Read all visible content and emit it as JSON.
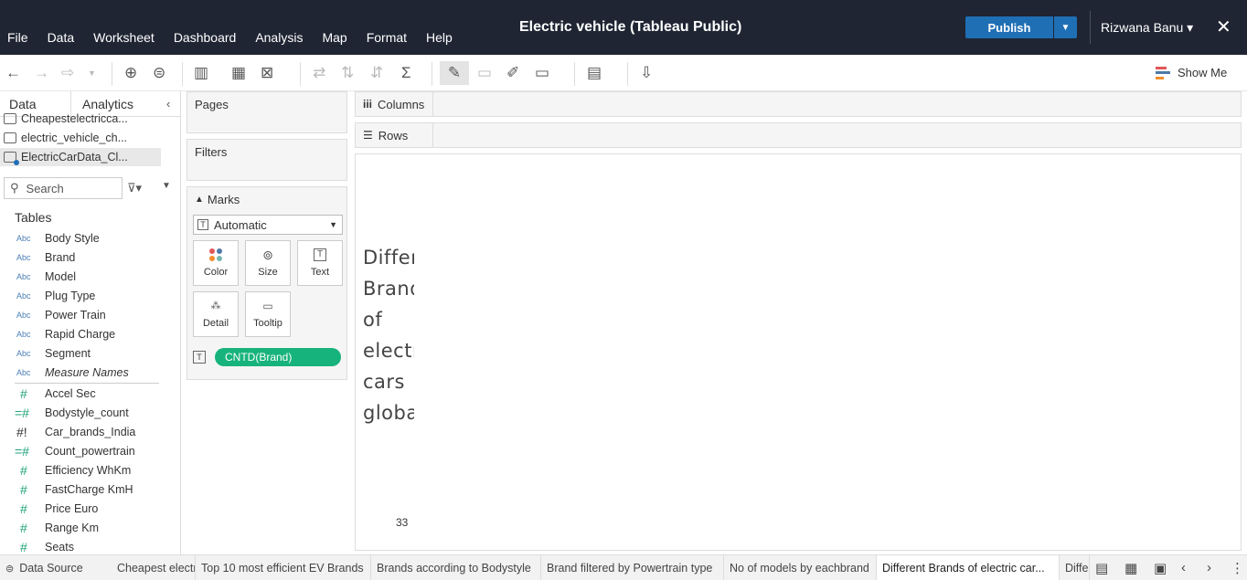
{
  "menu": [
    "File",
    "Data",
    "Worksheet",
    "Dashboard",
    "Analysis",
    "Map",
    "Format",
    "Help"
  ],
  "app_title": "Electric vehicle (Tableau Public)",
  "publish_label": "Publish",
  "user_name": "Rizwana Banu ▾",
  "toolbar": {
    "show_me_label": "Show Me"
  },
  "data_pane": {
    "tab_data": "Data",
    "tab_analytics": "Analytics",
    "sources": [
      "Cheapestelectricca...",
      "electric_vehicle_ch...",
      "ElectricCarData_Cl..."
    ],
    "search_placeholder": "Search",
    "tables_label": "Tables",
    "dimensions": [
      {
        "type": "Abc",
        "name": "Body Style"
      },
      {
        "type": "Abc",
        "name": "Brand"
      },
      {
        "type": "Abc",
        "name": "Model"
      },
      {
        "type": "Abc",
        "name": "Plug Type"
      },
      {
        "type": "Abc",
        "name": "Power Train"
      },
      {
        "type": "Abc",
        "name": "Rapid Charge"
      },
      {
        "type": "Abc",
        "name": "Segment"
      },
      {
        "type": "Abc",
        "name": "Measure Names"
      }
    ],
    "measures": [
      {
        "type": "#",
        "name": "Accel Sec"
      },
      {
        "type": "=#",
        "name": "Bodystyle_count"
      },
      {
        "type": "#!",
        "name": "Car_brands_India"
      },
      {
        "type": "=#",
        "name": "Count_powertrain"
      },
      {
        "type": "#",
        "name": "Efficiency WhKm"
      },
      {
        "type": "#",
        "name": "FastCharge KmH"
      },
      {
        "type": "#",
        "name": "Price Euro"
      },
      {
        "type": "#",
        "name": "Range Km"
      },
      {
        "type": "#",
        "name": "Seats"
      }
    ]
  },
  "cards": {
    "pages": "Pages",
    "filters": "Filters",
    "marks": "Marks",
    "mark_type": "Automatic",
    "mark_buttons": [
      "Color",
      "Size",
      "Text",
      "Detail",
      "Tooltip"
    ],
    "pill": "CNTD(Brand)"
  },
  "shelves": {
    "columns": "Columns",
    "rows": "Rows"
  },
  "viz": {
    "title": "Different\nBrands\nof\nelectric\ncars\nglobally",
    "value": "33"
  },
  "sheets": {
    "data_source": "Data Source",
    "tabs": [
      "Cheapest electric cars in India",
      "Top 10 most efficient EV Brands",
      "Brands according to Bodystyle",
      "Brand filtered by Powertrain type",
      "No of models by eachbrand",
      "Different Brands of electric car...",
      "Different"
    ],
    "active_index": 5
  },
  "colors": {
    "topbar": "#1f2533",
    "publish": "#1f6fb5",
    "pill": "#17b37c",
    "dimension_icon": "#4a7fb5",
    "measure_icon": "#1fa37a"
  }
}
